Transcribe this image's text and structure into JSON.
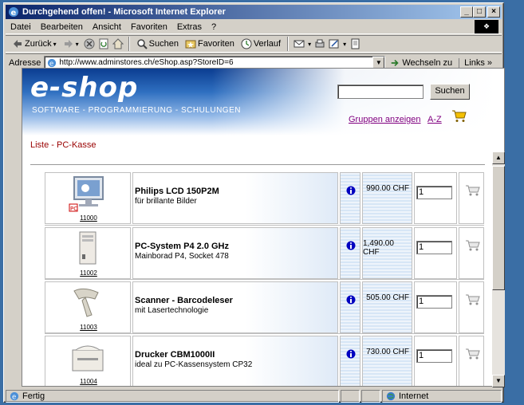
{
  "window": {
    "title": "Durchgehend offen! - Microsoft Internet Explorer"
  },
  "menu": [
    "Datei",
    "Bearbeiten",
    "Ansicht",
    "Favoriten",
    "Extras",
    "?"
  ],
  "toolbar": {
    "back": "Zurück",
    "search": "Suchen",
    "favorites": "Favoriten",
    "history": "Verlauf"
  },
  "address": {
    "label": "Adresse",
    "url": "http://www.adminstores.ch/eShop.asp?StoreID=6",
    "go": "Wechseln zu",
    "links": "Links"
  },
  "shop": {
    "logo": "e-shop",
    "tagline": "SOFTWARE - PROGRAMMIERUNG - SCHULUNGEN",
    "search_button": "Suchen",
    "group_link": "Gruppen anzeigen",
    "az_link": "A-Z",
    "list_title": "Liste - PC-Kasse"
  },
  "products": [
    {
      "id": "11000",
      "name": "Philips LCD 150P2M",
      "desc": "für brillante Bilder",
      "price": "990.00 CHF",
      "qty": "1"
    },
    {
      "id": "11002",
      "name": "PC-System P4 2.0 GHz",
      "desc": "Mainborad P4, Socket 478",
      "price": "1,490.00 CHF",
      "qty": "1"
    },
    {
      "id": "11003",
      "name": "Scanner - Barcodeleser",
      "desc": "mit Lasertechnologie",
      "price": "505.00 CHF",
      "qty": "1"
    },
    {
      "id": "11004",
      "name": "Drucker CBM1000II",
      "desc": "ideal zu PC-Kassensystem CP32",
      "price": "730.00 CHF",
      "qty": "1"
    }
  ],
  "status": {
    "text": "Fertig",
    "zone": "Internet"
  }
}
